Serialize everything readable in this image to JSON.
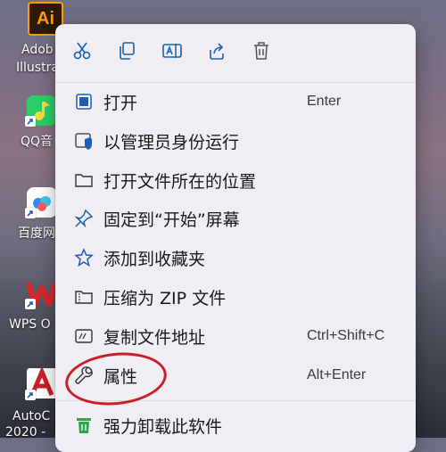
{
  "desktop": {
    "icons": [
      {
        "label": "Adob\nIllustra",
        "line1": "Adob",
        "line2": "Illustra",
        "glyph": "Ai"
      },
      {
        "label": "QQ音",
        "line1": "QQ音"
      },
      {
        "label": "百度网",
        "line1": "百度网"
      },
      {
        "label": "WPS O",
        "line1": "WPS O"
      },
      {
        "label": "AutoC 2020",
        "line1": "AutoC",
        "line2": "2020 -"
      }
    ]
  },
  "context_menu": {
    "toolbar": [
      {
        "name": "cut-icon"
      },
      {
        "name": "copy-icon"
      },
      {
        "name": "rename-icon"
      },
      {
        "name": "share-icon"
      },
      {
        "name": "delete-icon"
      }
    ],
    "items": [
      {
        "label": "打开",
        "shortcut": "Enter",
        "icon": "open-icon"
      },
      {
        "label": "以管理员身份运行",
        "shortcut": "",
        "icon": "admin-shield-icon"
      },
      {
        "label": "打开文件所在的位置",
        "shortcut": "",
        "icon": "folder-icon"
      },
      {
        "label": "固定到“开始”屏幕",
        "shortcut": "",
        "icon": "pin-icon"
      },
      {
        "label": "添加到收藏夹",
        "shortcut": "",
        "icon": "star-icon"
      },
      {
        "label": "压缩为 ZIP 文件",
        "shortcut": "",
        "icon": "zip-folder-icon"
      },
      {
        "label": "复制文件地址",
        "shortcut": "Ctrl+Shift+C",
        "icon": "copy-path-icon"
      },
      {
        "label": "属性",
        "shortcut": "Alt+Enter",
        "icon": "wrench-icon"
      },
      {
        "label": "强力卸载此软件",
        "shortcut": "",
        "icon": "uninstall-trash-icon"
      }
    ]
  },
  "colors": {
    "accent": "#1a5fb4",
    "annotation": "#c8202a",
    "menu_bg": "#f0edf3"
  }
}
